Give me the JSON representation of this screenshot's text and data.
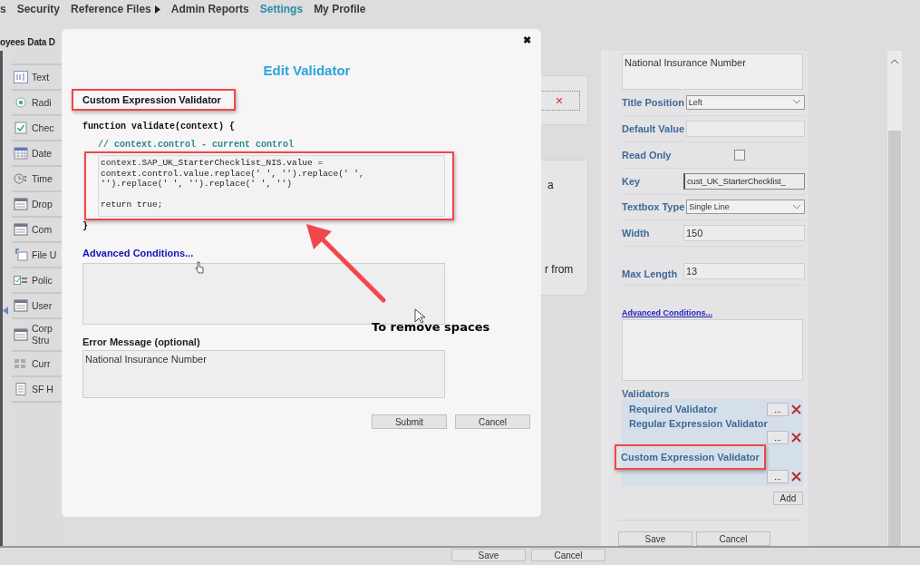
{
  "nav": {
    "items": [
      {
        "label": "s",
        "selected": false,
        "submenu": false
      },
      {
        "label": "Security",
        "selected": false,
        "submenu": false
      },
      {
        "label": "Reference Files",
        "selected": false,
        "submenu": true
      },
      {
        "label": "Admin Reports",
        "selected": false,
        "submenu": false
      },
      {
        "label": "Settings",
        "selected": true,
        "submenu": false
      },
      {
        "label": "My Profile",
        "selected": false,
        "submenu": false
      }
    ]
  },
  "subnav": [
    "oyees",
    "Data D"
  ],
  "palette": [
    {
      "label": "Text",
      "kind": "text"
    },
    {
      "label": "Radi",
      "kind": "radio"
    },
    {
      "label": "Chec",
      "kind": "checkbox"
    },
    {
      "label": "Date",
      "kind": "calendar"
    },
    {
      "label": "Time",
      "kind": "clock"
    },
    {
      "label": "Drop",
      "kind": "window"
    },
    {
      "label": "Com",
      "kind": "window"
    },
    {
      "label": "File U",
      "kind": "file"
    },
    {
      "label": "Polic",
      "kind": "policy"
    },
    {
      "label": "User",
      "kind": "window"
    },
    {
      "label": "Corp\nStru",
      "kind": "window"
    },
    {
      "label": "Curr",
      "kind": "blocks"
    },
    {
      "label": "SF H",
      "kind": "document"
    }
  ],
  "canvas_fragments": [
    "a",
    "r from"
  ],
  "modal": {
    "close": "✖",
    "title": "Edit Validator",
    "validator_type": "Custom Expression Validator",
    "type_highlighted": true,
    "code_header": "function validate(context) {",
    "comment": "// context.control - current control",
    "code": "context.SAP_UK_StarterChecklist_NIS.value =\ncontext.control.value.replace(' ', '').replace(' ',\n'').replace(' ', '').replace(' ', '')\n\nreturn true;",
    "code_highlighted": true,
    "code_footer": "}",
    "advanced_link": "Advanced Conditions...",
    "error_label": "Error Message (optional)",
    "error_value": "National Insurance Number",
    "buttons": [
      "Submit",
      "Cancel"
    ]
  },
  "annotation": {
    "text": "To remove spaces"
  },
  "properties": {
    "description": "National Insurance Number",
    "fields": [
      {
        "kind": "select",
        "label": "Title Position",
        "value": "Left"
      },
      {
        "kind": "input",
        "label": "Default Value"
      },
      {
        "kind": "checkbox",
        "label": "Read Only",
        "checked": false
      },
      {
        "kind": "input",
        "label": "Key",
        "value": "cust_UK_StarterChecklist_"
      },
      {
        "kind": "select",
        "label": "Textbox Type",
        "value": "Single Line"
      },
      {
        "kind": "input",
        "label": "Width",
        "value": "150"
      },
      {
        "kind": "input",
        "label": "Max Length",
        "value": "13"
      }
    ],
    "advanced_link": "Advanced Conditions...",
    "validators_label": "Validators",
    "validators": [
      {
        "name": "Required Validator",
        "highlighted": false
      },
      {
        "name": "Regular Expression Validator",
        "highlighted": false
      },
      {
        "name": "Custom Expression Validator",
        "highlighted": true
      }
    ],
    "edit_label": "...",
    "add": "Add",
    "buttons": [
      "Save",
      "Cancel"
    ]
  },
  "footer_buttons": [
    "Save",
    "Cancel"
  ]
}
